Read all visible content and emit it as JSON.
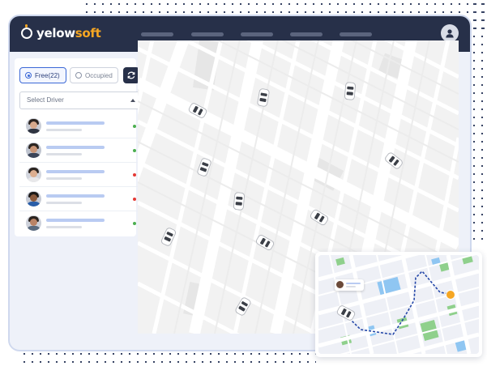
{
  "brand": {
    "part1": "yelow",
    "part2": "soft"
  },
  "tabs": {
    "free_label": "Free(22)",
    "occupied_label": "Occupied"
  },
  "select": {
    "placeholder": "Select Driver"
  },
  "drivers": [
    {
      "status": "available",
      "status_color": "#4caf50"
    },
    {
      "status": "available",
      "status_color": "#4caf50"
    },
    {
      "status": "busy",
      "status_color": "#e53935"
    },
    {
      "status": "busy",
      "status_color": "#e53935"
    },
    {
      "status": "available",
      "status_color": "#4caf50"
    }
  ],
  "colors": {
    "header": "#273049",
    "accent": "#f5a623",
    "primary": "#3b68d6"
  },
  "icons": {
    "refresh": "refresh-icon",
    "user": "user-icon",
    "caret": "caret-up-icon",
    "destination": "destination-pin-icon"
  }
}
